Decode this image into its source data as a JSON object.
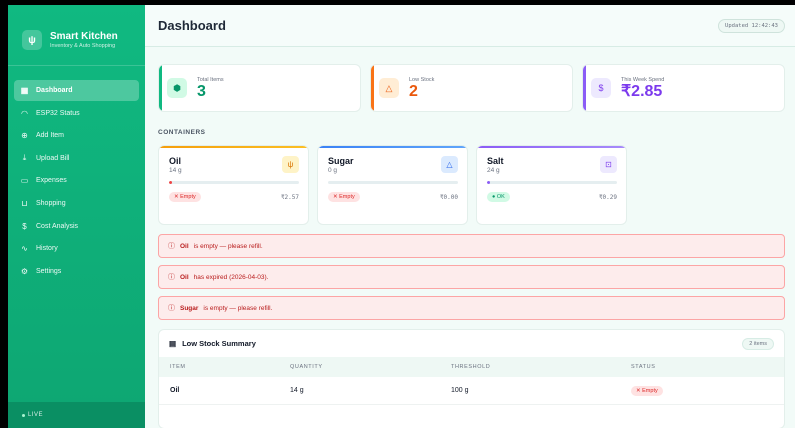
{
  "brand": {
    "title": "Smart Kitchen",
    "subtitle": "Inventory & Auto Shopping",
    "icon": "fork-knife-icon"
  },
  "sidebar": {
    "items": [
      {
        "label": "Dashboard",
        "icon": "grid-icon",
        "active": true
      },
      {
        "label": "ESP32 Status",
        "icon": "wifi-icon"
      },
      {
        "label": "Add Item",
        "icon": "plus-circle-icon"
      },
      {
        "label": "Upload Bill",
        "icon": "upload-icon"
      },
      {
        "label": "Expenses",
        "icon": "card-icon"
      },
      {
        "label": "Shopping",
        "icon": "cart-icon"
      },
      {
        "label": "Cost Analysis",
        "icon": "dollar-icon"
      },
      {
        "label": "History",
        "icon": "activity-icon"
      },
      {
        "label": "Settings",
        "icon": "gear-icon"
      }
    ],
    "status": "LIVE"
  },
  "header": {
    "title": "Dashboard",
    "updated": "Updated 12:42:43"
  },
  "stats": [
    {
      "label": "Total Items",
      "value": "3",
      "icon": "cube-icon"
    },
    {
      "label": "Low Stock",
      "value": "2",
      "icon": "warning-icon"
    },
    {
      "label": "This Week Spend",
      "value": "₹2.85",
      "icon": "coin-icon"
    }
  ],
  "containers_label": "CONTAINERS",
  "containers": [
    {
      "name": "Oil",
      "qty": "14 g",
      "status": "✕ Empty",
      "price": "₹2.57",
      "fill": 0.01
    },
    {
      "name": "Sugar",
      "qty": "0 g",
      "status": "✕ Empty",
      "price": "₹0.00",
      "fill": 0.0
    },
    {
      "name": "Salt",
      "qty": "24 g",
      "status": "● OK",
      "price": "₹0.29",
      "fill": 0.02
    }
  ],
  "alerts": [
    {
      "item": "Oil",
      "text": "is empty — please refill."
    },
    {
      "item": "Oil",
      "text": "has expired (2026-04-03)."
    },
    {
      "item": "Sugar",
      "text": "is empty — please refill."
    }
  ],
  "summary": {
    "title": "Low Stock Summary",
    "count": "2 items",
    "columns": [
      "ITEM",
      "QUANTITY",
      "THRESHOLD",
      "STATUS"
    ],
    "rows": [
      {
        "item": "Oil",
        "quantity": "14 g",
        "threshold": "100 g",
        "status": "✕ Empty"
      }
    ]
  },
  "colors": {
    "primary": "#10b981",
    "danger": "#dc2626",
    "warning": "#ea580c",
    "purple": "#7c3aed"
  }
}
